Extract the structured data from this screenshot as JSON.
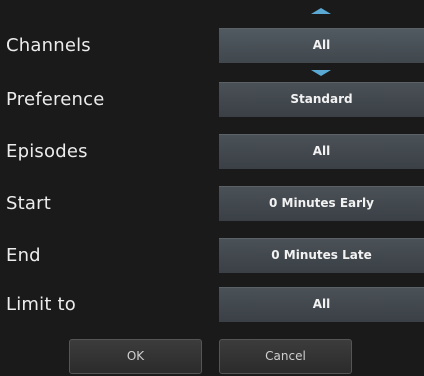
{
  "rows": [
    {
      "label": "Channels",
      "value": "All"
    },
    {
      "label": "Preference",
      "value": "Standard"
    },
    {
      "label": "Episodes",
      "value": "All"
    },
    {
      "label": "Start",
      "value": "0 Minutes Early"
    },
    {
      "label": "End",
      "value": "0 Minutes Late"
    },
    {
      "label": "Limit to",
      "value": "All"
    }
  ],
  "buttons": {
    "ok_label": "OK",
    "cancel_label": "Cancel"
  },
  "icons": {
    "scroll_up": "arrow-up-icon",
    "scroll_down": "arrow-down-icon"
  },
  "colors": {
    "accent": "#59a9d4",
    "background": "#1a1a1a",
    "field": "#3e454a"
  }
}
